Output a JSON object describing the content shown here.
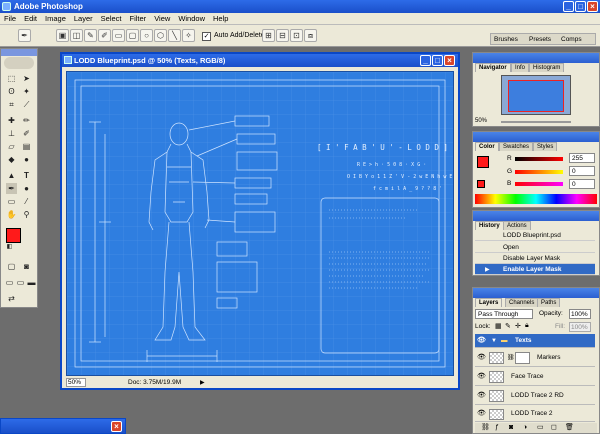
{
  "app": {
    "title": "Adobe Photoshop"
  },
  "menu": [
    "File",
    "Edit",
    "Image",
    "Layer",
    "Select",
    "Filter",
    "View",
    "Window",
    "Help"
  ],
  "options": {
    "auto_add_delete": "Auto Add/Delete",
    "tabs": [
      "Brushes",
      "Presets",
      "Comps"
    ]
  },
  "document": {
    "title": "LODD Blueprint.psd @ 50% (Texts, RGB/8)",
    "zoom": "50%",
    "doc_info": "Doc: 3.75M/19.9M",
    "heading": "[ I ' F A B ' U '  -  L O D D ]",
    "line2": "R E > h · 5 0 8 · X G ·",
    "line3": "O I B Y o 1 1 Z ' V - 2 w E N h w E",
    "line4": "f c m i l A _ 9 ? ? 8 '"
  },
  "navigator": {
    "tabs": [
      "Navigator",
      "Info",
      "Histogram"
    ],
    "zoom": "50%"
  },
  "color": {
    "tabs": [
      "Color",
      "Swatches",
      "Styles"
    ],
    "r_label": "R",
    "g_label": "G",
    "b_label": "B",
    "r": "255",
    "g": "0",
    "b": "0",
    "fg": "#ff1a1a"
  },
  "history": {
    "tabs": [
      "History",
      "Actions"
    ],
    "snapshot": "LODD Blueprint.psd",
    "items": [
      "Open",
      "Disable Layer Mask",
      "Enable Layer Mask"
    ]
  },
  "layers": {
    "tabs": [
      "Layers",
      "Channels",
      "Paths"
    ],
    "blend_mode": "Pass Through",
    "opacity_label": "Opacity:",
    "opacity": "100%",
    "lock_label": "Lock:",
    "fill_label": "Fill:",
    "fill": "100%",
    "items": [
      "Texts",
      "Markers",
      "Face Trace",
      "LODD Trace 2 RD",
      "LODD Trace 2"
    ]
  },
  "colors": {
    "accent": "#1a4fc9",
    "canvas": "#2f7ee0",
    "selected": "#316ac5"
  }
}
